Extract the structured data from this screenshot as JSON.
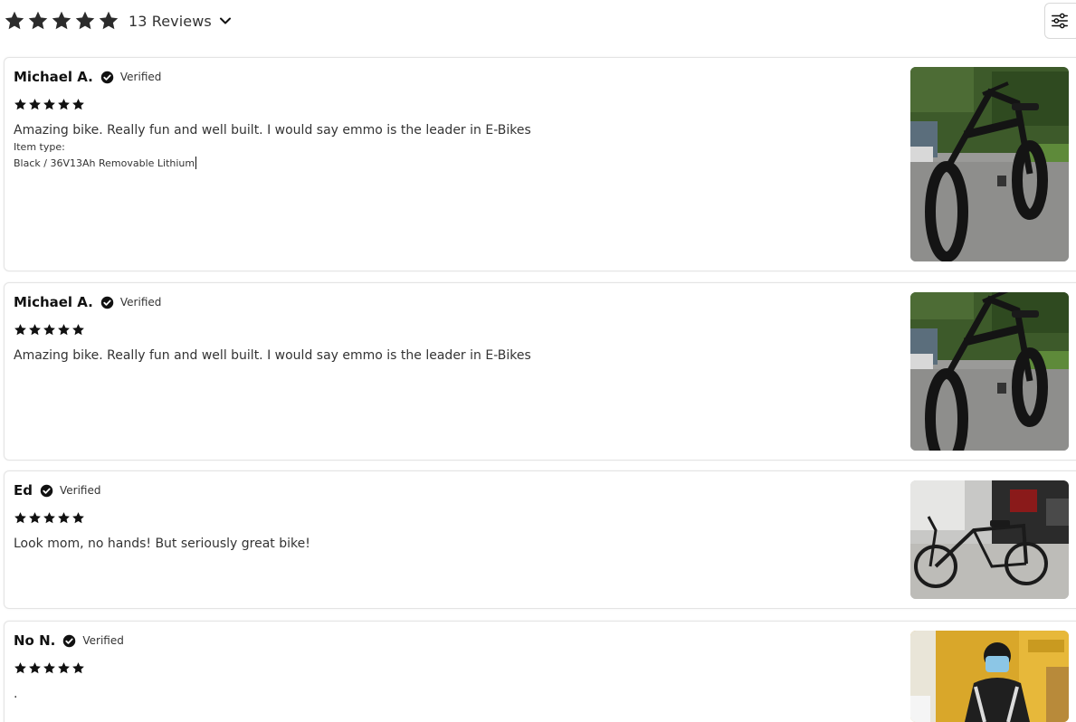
{
  "summary": {
    "rating": 5,
    "reviews_label": "13 Reviews",
    "star_color": "#2b2b2b"
  },
  "filter": {
    "icon": "sliders-icon"
  },
  "reviews": [
    {
      "author": "Michael A.",
      "verified_label": "Verified",
      "rating": 5,
      "text": "Amazing bike. Really fun and well built. I would say emmo is the leader in E-Bikes",
      "item_type_label": "Item type:",
      "item_type_value": "Black / 36V13Ah Removable Lithium",
      "photo": "ebike-photo"
    },
    {
      "author": "Michael A.",
      "verified_label": "Verified",
      "rating": 5,
      "text": "Amazing bike. Really fun and well built. I would say emmo is the leader in E-Bikes",
      "photo": "ebike-photo"
    },
    {
      "author": "Ed",
      "verified_label": "Verified",
      "rating": 5,
      "text": "Look mom, no hands! But seriously great bike!",
      "photo": "ebike-indoor-photo"
    },
    {
      "author": "No N.",
      "verified_label": "Verified",
      "rating": 5,
      "text": ".",
      "photo": "rider-helmet-photo"
    }
  ]
}
